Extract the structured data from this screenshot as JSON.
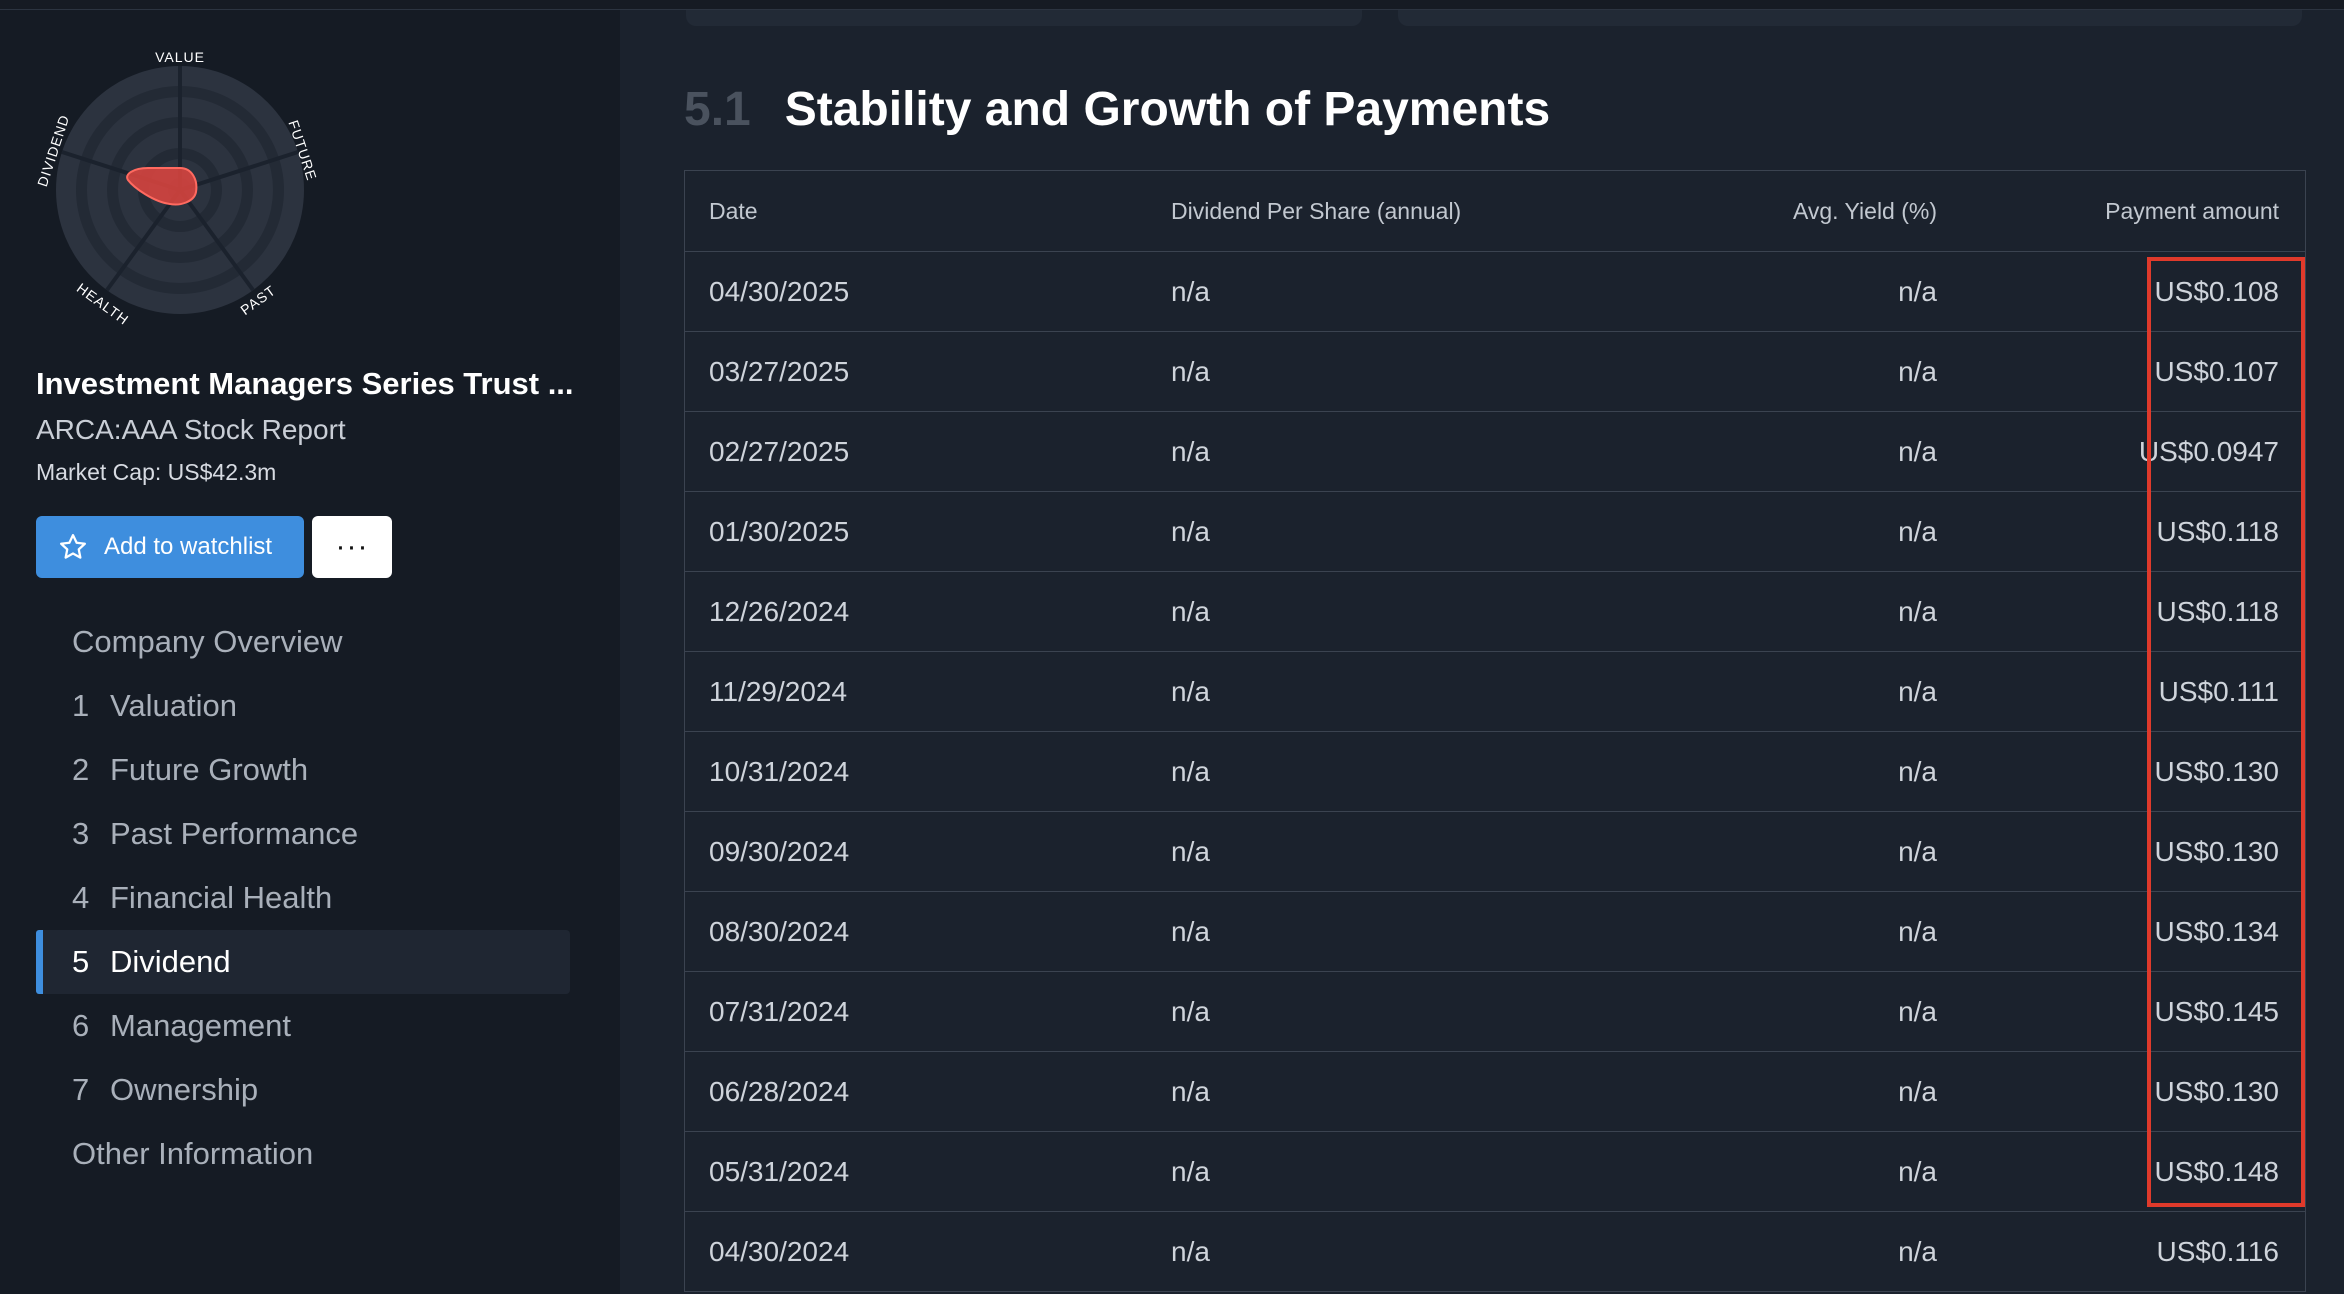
{
  "snowflake": {
    "labels": [
      "VALUE",
      "FUTURE",
      "PAST",
      "HEALTH",
      "DIVIDEND"
    ],
    "fill_color": "#e0453f"
  },
  "company": {
    "name": "Investment Managers Series Trust ...",
    "ticker_report": "ARCA:AAA Stock Report",
    "market_cap": "Market Cap: US$42.3m"
  },
  "actions": {
    "watchlist_label": "Add to watchlist",
    "more_label": "···"
  },
  "nav": [
    {
      "num": "",
      "label": "Company Overview"
    },
    {
      "num": "1",
      "label": "Valuation"
    },
    {
      "num": "2",
      "label": "Future Growth"
    },
    {
      "num": "3",
      "label": "Past Performance"
    },
    {
      "num": "4",
      "label": "Financial Health"
    },
    {
      "num": "5",
      "label": "Dividend",
      "active": true
    },
    {
      "num": "6",
      "label": "Management"
    },
    {
      "num": "7",
      "label": "Ownership"
    },
    {
      "num": "",
      "label": "Other Information"
    }
  ],
  "section": {
    "number": "5.1",
    "title": "Stability and Growth of Payments"
  },
  "table": {
    "headers": [
      "Date",
      "Dividend Per Share (annual)",
      "Avg. Yield (%)",
      "Payment amount"
    ],
    "rows": [
      [
        "04/30/2025",
        "n/a",
        "n/a",
        "US$0.108"
      ],
      [
        "03/27/2025",
        "n/a",
        "n/a",
        "US$0.107"
      ],
      [
        "02/27/2025",
        "n/a",
        "n/a",
        "US$0.0947"
      ],
      [
        "01/30/2025",
        "n/a",
        "n/a",
        "US$0.118"
      ],
      [
        "12/26/2024",
        "n/a",
        "n/a",
        "US$0.118"
      ],
      [
        "11/29/2024",
        "n/a",
        "n/a",
        "US$0.111"
      ],
      [
        "10/31/2024",
        "n/a",
        "n/a",
        "US$0.130"
      ],
      [
        "09/30/2024",
        "n/a",
        "n/a",
        "US$0.130"
      ],
      [
        "08/30/2024",
        "n/a",
        "n/a",
        "US$0.134"
      ],
      [
        "07/31/2024",
        "n/a",
        "n/a",
        "US$0.145"
      ],
      [
        "06/28/2024",
        "n/a",
        "n/a",
        "US$0.130"
      ],
      [
        "05/31/2024",
        "n/a",
        "n/a",
        "US$0.148"
      ],
      [
        "04/30/2024",
        "n/a",
        "n/a",
        "US$0.116"
      ]
    ]
  },
  "colors": {
    "accent": "#3e8ede",
    "highlight": "#e03a2b"
  }
}
